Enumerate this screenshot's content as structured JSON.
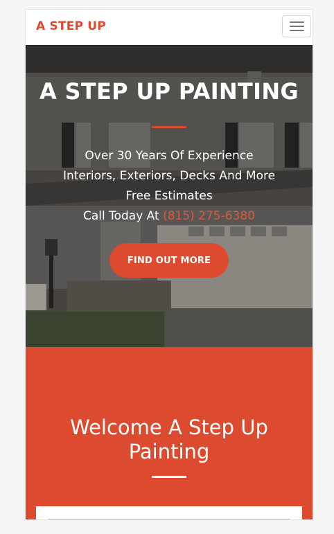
{
  "navbar": {
    "brand": "A STEP UP",
    "menu_icon": "hamburger-menu-icon"
  },
  "hero": {
    "title": "A STEP UP PAINTING",
    "lines": [
      "Over 30 Years Of Experience",
      "Interiors, Exteriors, Decks And More",
      "Free Estimates"
    ],
    "call_prefix": "Call Today At",
    "phone": "(815) 275-6380",
    "cta_label": "FIND OUT MORE"
  },
  "welcome": {
    "title_line1": "Welcome A Step Up",
    "title_line2": "Painting"
  },
  "colors": {
    "accent": "#dc4a30",
    "phone": "#e0583c",
    "text_on_dark": "#ffffff"
  }
}
